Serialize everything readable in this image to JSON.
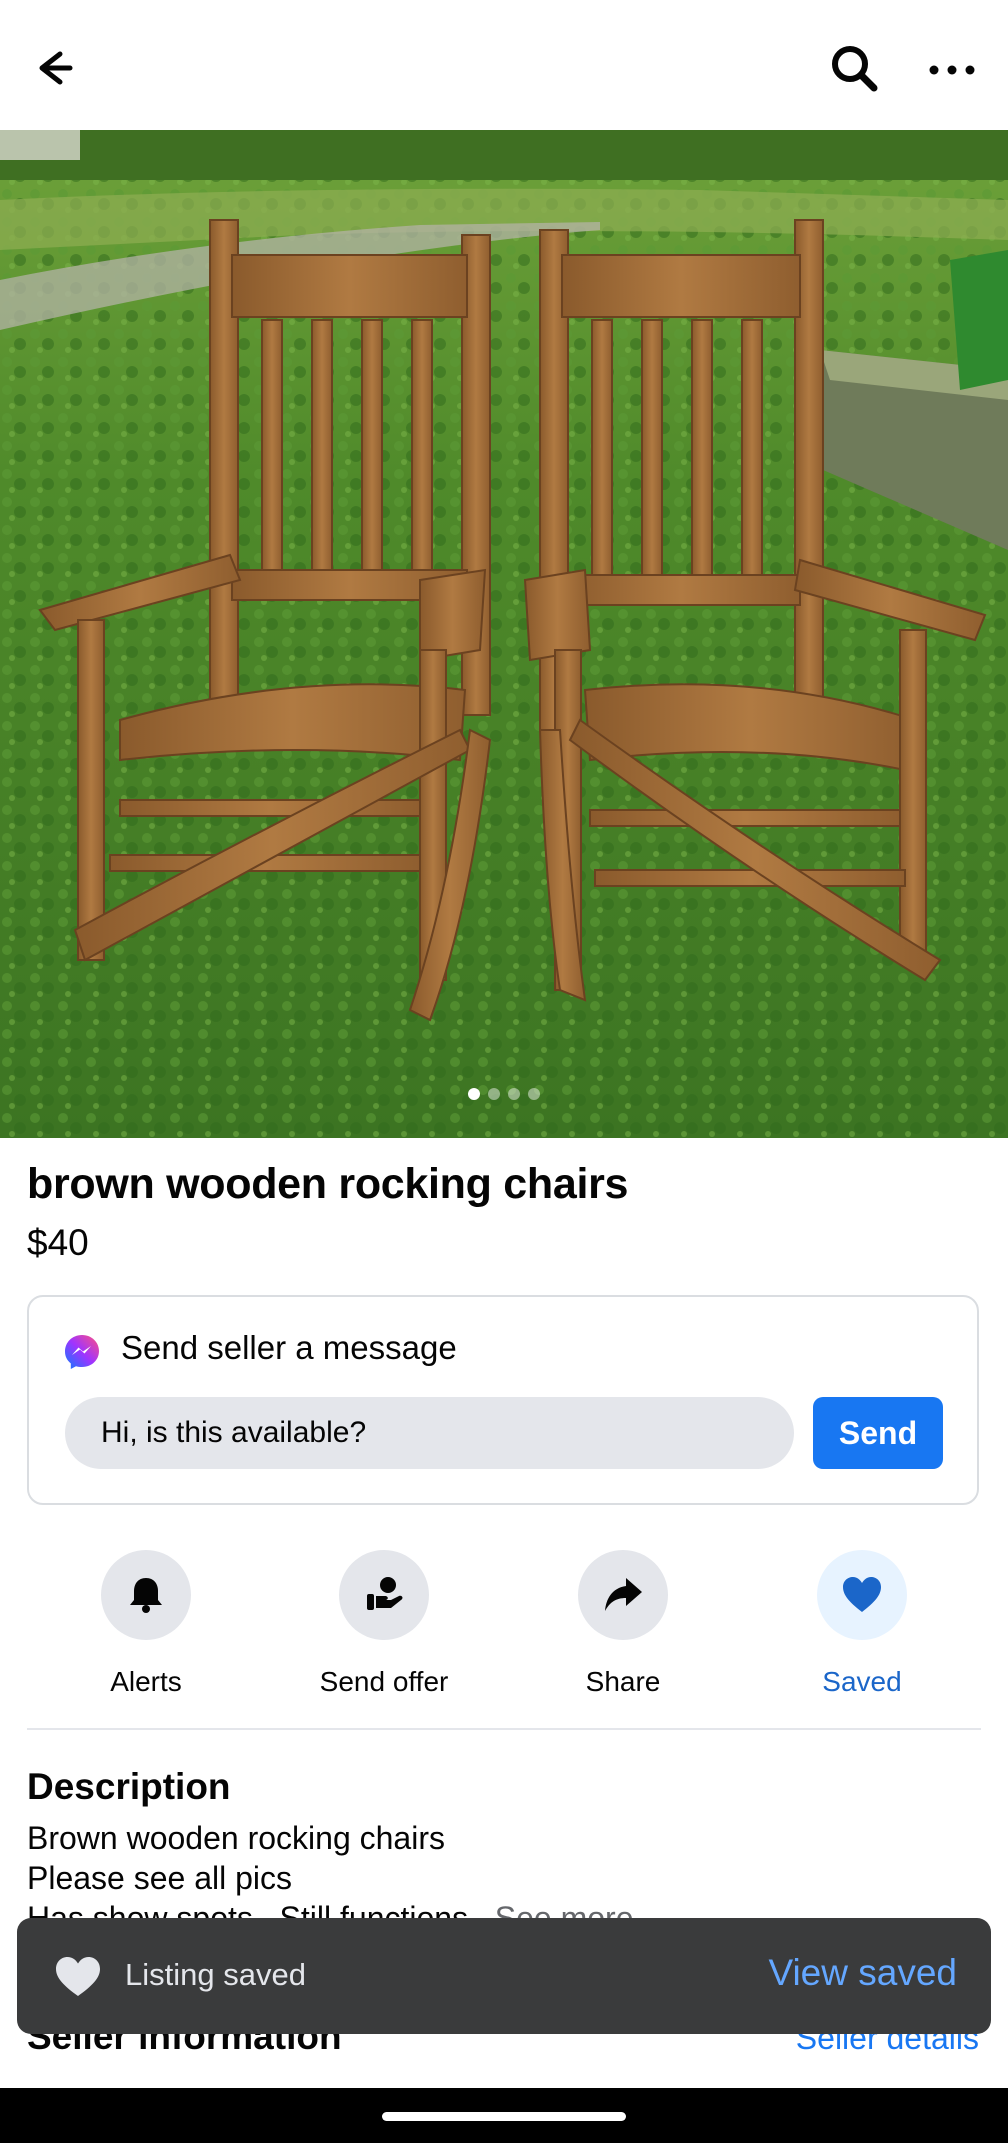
{
  "header": {
    "back_icon": "back-arrow-icon",
    "search_icon": "search-icon",
    "more_icon": "more-options-icon"
  },
  "gallery": {
    "page_count": 4,
    "active_index": 0
  },
  "listing": {
    "title": "brown wooden rocking chairs",
    "price": "$40"
  },
  "message_card": {
    "title": "Send seller a message",
    "input_value": "Hi, is this available?",
    "send_label": "Send",
    "accent": "#1877f2"
  },
  "actions": [
    {
      "label": "Alerts",
      "icon": "bell-icon"
    },
    {
      "label": "Send offer",
      "icon": "offer-icon"
    },
    {
      "label": "Share",
      "icon": "share-icon"
    },
    {
      "label": "Saved",
      "icon": "heart-icon",
      "active_color": "#1b66c9"
    }
  ],
  "description": {
    "heading": "Description",
    "lines": [
      "Brown wooden rocking chairs",
      "Please see all pics",
      "Has show spots . Still functions"
    ],
    "see_more": "See more"
  },
  "seller": {
    "heading": "Seller information",
    "link": "Seller details"
  },
  "toast": {
    "text": "Listing saved",
    "link": "View saved"
  }
}
